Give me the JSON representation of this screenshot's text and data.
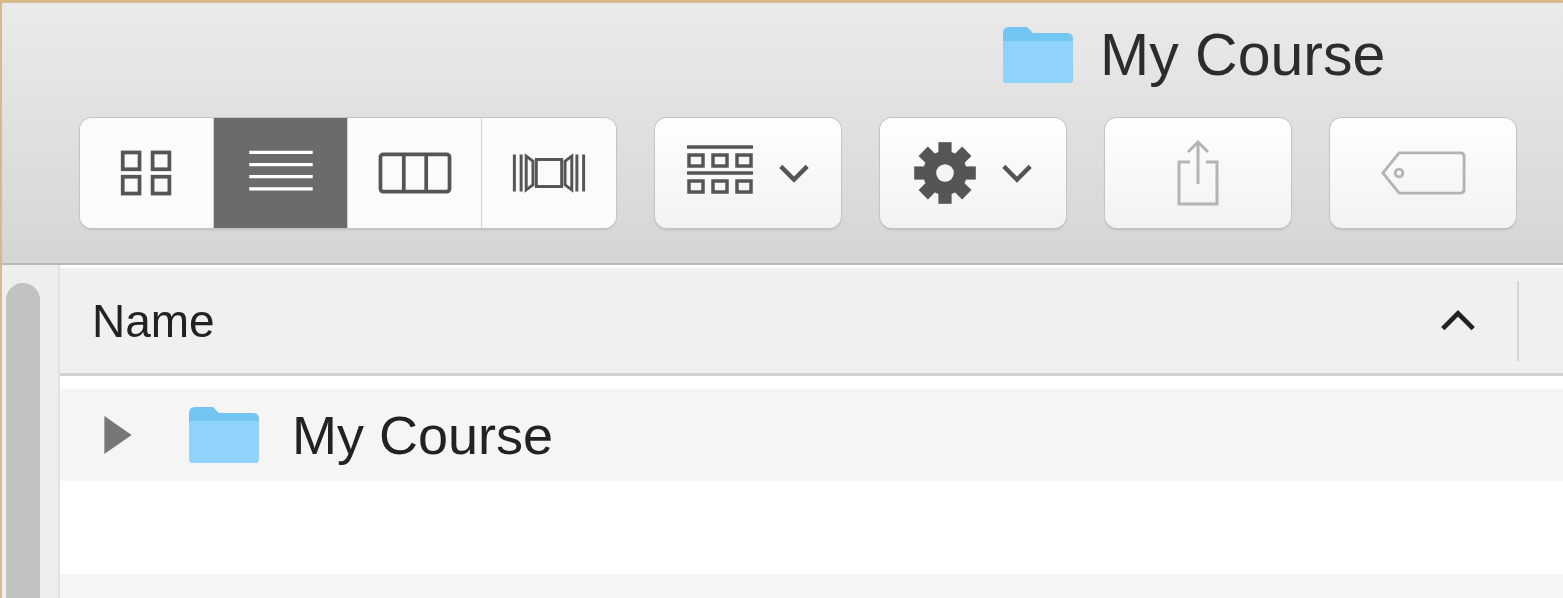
{
  "window": {
    "title": "My Course"
  },
  "toolbar": {
    "view_buttons": [
      {
        "kind": "icons",
        "selected": false
      },
      {
        "kind": "list",
        "selected": true
      },
      {
        "kind": "columns",
        "selected": false
      },
      {
        "kind": "coverflow",
        "selected": false
      }
    ],
    "buttons": [
      {
        "kind": "arrange",
        "disabled": false
      },
      {
        "kind": "action",
        "disabled": false
      },
      {
        "kind": "share",
        "disabled": true
      },
      {
        "kind": "tag",
        "disabled": true
      }
    ]
  },
  "table": {
    "columns": [
      {
        "label": "Name",
        "sorted": true
      }
    ],
    "rows": [
      {
        "name": "My Course",
        "expanded": false
      }
    ]
  }
}
